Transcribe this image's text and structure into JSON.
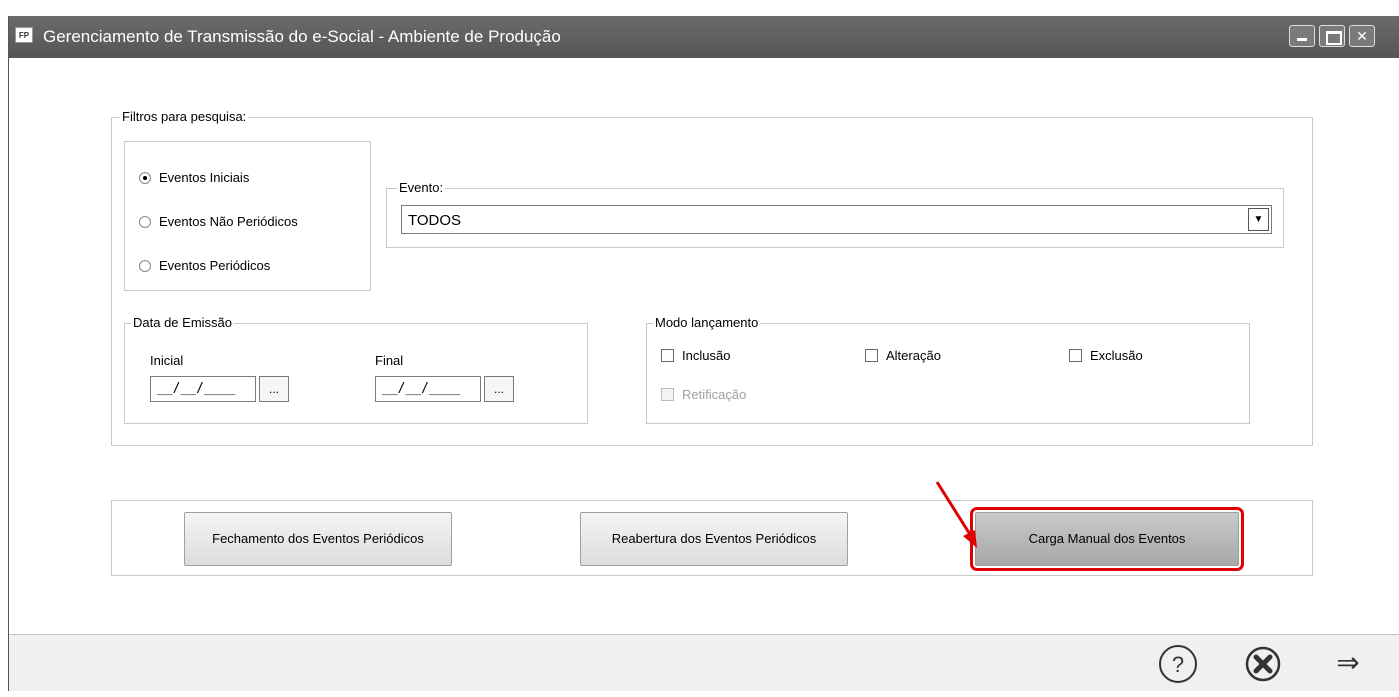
{
  "window": {
    "title": "Gerenciamento de Transmissão do e-Social - Ambiente de Produção",
    "app_icon_text": "FP"
  },
  "filters": {
    "legend": "Filtros para pesquisa:",
    "event_types": [
      {
        "label": "Eventos Iniciais",
        "checked": true
      },
      {
        "label": "Eventos Não Periódicos",
        "checked": false
      },
      {
        "label": "Eventos Periódicos",
        "checked": false
      }
    ],
    "evento": {
      "legend": "Evento:",
      "value": "TODOS"
    },
    "data_emissao": {
      "legend": "Data de Emissão",
      "initial_label": "Inicial",
      "initial_value": "__/__/____",
      "final_label": "Final",
      "final_value": "__/__/____",
      "picker_label": "..."
    },
    "modo_lancamento": {
      "legend": "Modo lançamento",
      "options": [
        {
          "label": "Inclusão",
          "checked": false,
          "enabled": true
        },
        {
          "label": "Alteração",
          "checked": false,
          "enabled": true
        },
        {
          "label": "Exclusão",
          "checked": false,
          "enabled": true
        },
        {
          "label": "Retificação",
          "checked": false,
          "enabled": false
        }
      ]
    }
  },
  "actions": {
    "fechamento": "Fechamento dos Eventos Periódicos",
    "reabertura": "Reabertura dos Eventos Periódicos",
    "carga": "Carga Manual dos Eventos"
  },
  "footer": {
    "help_icon": "?",
    "cancel_icon": "✖",
    "next_icon": "⇒"
  },
  "colors": {
    "highlight": "#e00000",
    "titlebar": "#5f5f5f"
  }
}
